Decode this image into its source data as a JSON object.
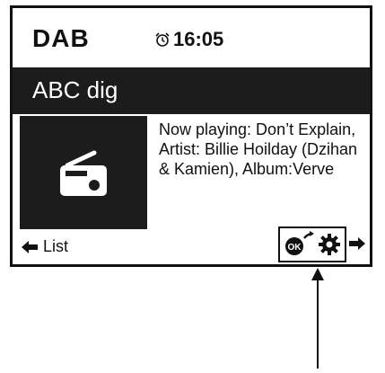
{
  "header": {
    "mode": "DAB",
    "time": "16:05",
    "alarm_icon": "alarm-clock-icon"
  },
  "station": {
    "name": "ABC dig"
  },
  "artwork": {
    "icon": "radio-icon"
  },
  "now_playing": {
    "text": "Now playing: Don’t Explain, Artist: Billie Hoilday (Dzihan & Kamien), Album:Verve"
  },
  "footer": {
    "back_label": "List",
    "back_icon": "left-arrow-icon",
    "actions": [
      {
        "icon": "ok-select-icon"
      },
      {
        "icon": "gear-icon"
      }
    ],
    "forward_icon": "right-arrow-icon"
  },
  "colors": {
    "screen_bg": "#ffffff",
    "bar_bg": "#1c1c1c",
    "text": "#111111"
  }
}
